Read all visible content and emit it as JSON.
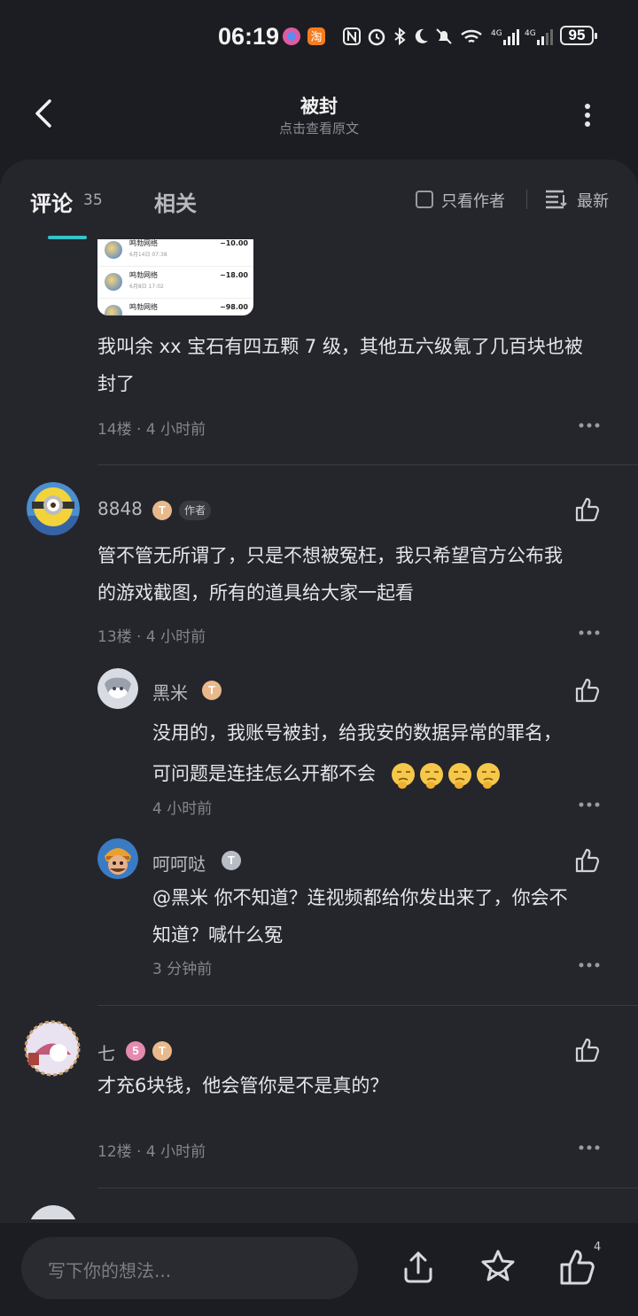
{
  "status": {
    "time": "06:19",
    "battery": "95"
  },
  "nav": {
    "title": "被封",
    "subtitle": "点击查看原文"
  },
  "tabs": {
    "comments_label": "评论",
    "comments_count": "35",
    "related_label": "相关",
    "only_author": "只看作者",
    "sort_label": "最新"
  },
  "screenshot": {
    "rows": [
      {
        "name": "鸣勃网络",
        "date": "6月14日 07:38",
        "amount": "−10.00"
      },
      {
        "name": "鸣勃网络",
        "date": "6月8日 17:02",
        "amount": "−18.00"
      },
      {
        "name": "鸣勃网络",
        "date": "",
        "amount": "−98.00"
      }
    ]
  },
  "comments": [
    {
      "text_line1": "我叫余 xx 宝石有四五颗 7 级，其他五六级氪了几百块也被",
      "text_line2": "封了",
      "meta": "14楼 · 4 小时前"
    },
    {
      "user": "8848",
      "badge": "T",
      "author_tag": "作者",
      "text_line1": "管不管无所谓了，只是不想被冤枉，我只希望官方公布我",
      "text_line2": "的游戏截图，所有的道具给大家一起看",
      "meta": "13楼 · 4 小时前",
      "replies": [
        {
          "user": "黑米",
          "badge": "T",
          "text_line1": "没用的，我账号被封，给我安的数据异常的罪名，",
          "text_line2": "可问题是连挂怎么开都不会",
          "meta": "4 小时前"
        },
        {
          "user": "呵呵哒",
          "badge": "T",
          "text_line1": "@黑米  你不知道？连视频都给你发出来了，你会不",
          "text_line2": "知道？喊什么冤",
          "meta": "3 分钟前"
        }
      ]
    },
    {
      "user": "七",
      "badge1": "5",
      "badge": "T",
      "text_line1": "才充6块钱，他会管你是不是真的？",
      "meta": "12楼 · 4 小时前"
    }
  ],
  "bottom": {
    "placeholder": "写下你的想法...",
    "like_count": "4"
  },
  "colors": {
    "background": "#1c1d22",
    "panel": "#25262c",
    "accent": "#34c3c8"
  }
}
